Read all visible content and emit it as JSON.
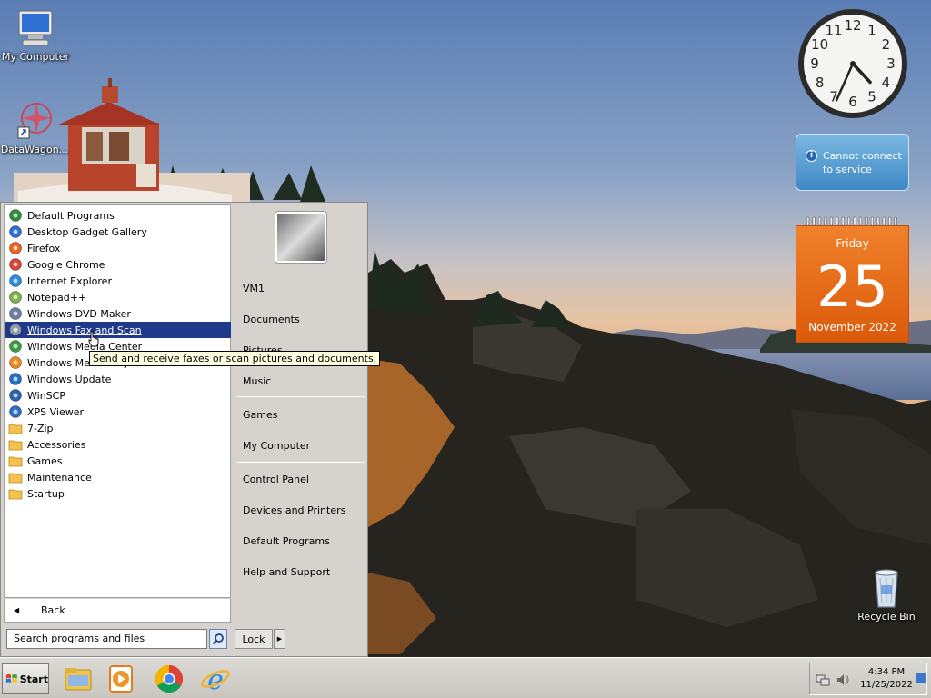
{
  "desktop": {
    "icons": [
      {
        "label": "My Computer"
      },
      {
        "label": "DataWagon..."
      },
      {
        "label": "Recycle Bin"
      }
    ]
  },
  "start_menu": {
    "programs": [
      {
        "label": "Default Programs",
        "icon": "default-programs-icon"
      },
      {
        "label": "Desktop Gadget Gallery",
        "icon": "gadget-gallery-icon"
      },
      {
        "label": "Firefox",
        "icon": "firefox-icon"
      },
      {
        "label": "Google Chrome",
        "icon": "chrome-icon"
      },
      {
        "label": "Internet Explorer",
        "icon": "internet-explorer-icon"
      },
      {
        "label": "Notepad++",
        "icon": "notepadpp-icon"
      },
      {
        "label": "Windows DVD Maker",
        "icon": "dvd-maker-icon"
      },
      {
        "label": "Windows Fax and Scan",
        "icon": "fax-scan-icon",
        "selected": true
      },
      {
        "label": "Windows Media Center",
        "icon": "media-center-icon"
      },
      {
        "label": "Windows Media Player",
        "icon": "media-player-icon"
      },
      {
        "label": "Windows Update",
        "icon": "windows-update-icon"
      },
      {
        "label": "WinSCP",
        "icon": "winscp-icon"
      },
      {
        "label": "XPS Viewer",
        "icon": "xps-viewer-icon"
      },
      {
        "label": "7-Zip",
        "icon": "folder-icon"
      },
      {
        "label": "Accessories",
        "icon": "folder-icon"
      },
      {
        "label": "Games",
        "icon": "folder-icon"
      },
      {
        "label": "Maintenance",
        "icon": "folder-icon"
      },
      {
        "label": "Startup",
        "icon": "folder-icon"
      }
    ],
    "back_label": "Back",
    "search_placeholder": "Search programs and files",
    "right_items": [
      {
        "label": "VM1"
      },
      {
        "label": "Documents"
      },
      {
        "label": "Pictures"
      },
      {
        "label": "Music"
      },
      {
        "label": "Games"
      },
      {
        "label": "My Computer"
      },
      {
        "label": "Control Panel"
      },
      {
        "label": "Devices and Printers"
      },
      {
        "label": "Default Programs"
      },
      {
        "label": "Help and Support"
      }
    ],
    "lock_label": "Lock",
    "tooltip": "Send and receive faxes or scan pictures and documents."
  },
  "gadgets": {
    "clock": {
      "hour": 4,
      "minute": 34
    },
    "weather_message": [
      "Cannot connect",
      "to service"
    ],
    "calendar": {
      "day": "Friday",
      "date": "25",
      "month": "November 2022"
    }
  },
  "taskbar": {
    "start_label": "Start",
    "time": "4:34 PM",
    "date": "11/25/2022"
  }
}
